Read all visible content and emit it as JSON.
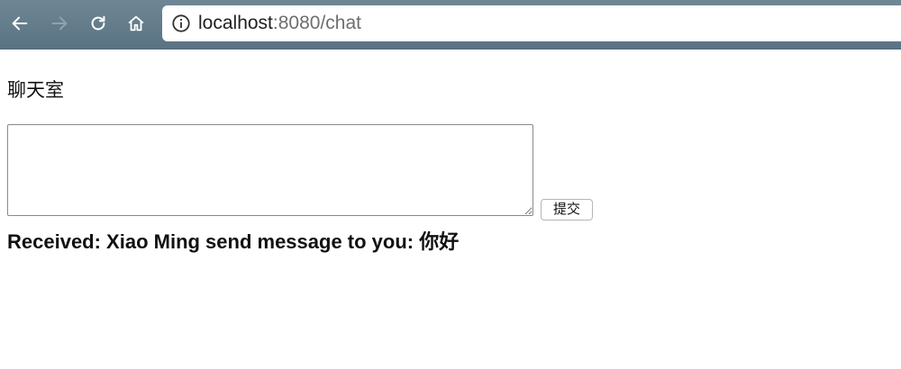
{
  "browser": {
    "back_icon": "back-arrow-icon",
    "forward_icon": "forward-arrow-icon",
    "reload_icon": "reload-icon",
    "home_icon": "home-icon",
    "info_icon": "info-icon",
    "url_host": "localhost",
    "url_rest": ":8080/chat"
  },
  "page": {
    "title": "聊天室",
    "message_value": "",
    "submit_label": "提交",
    "received_text": "Received: Xiao Ming send message to you: 你好"
  },
  "colors": {
    "toolbar": "#5f7886",
    "text": "#111111",
    "url_rest": "#6e6e6e"
  }
}
